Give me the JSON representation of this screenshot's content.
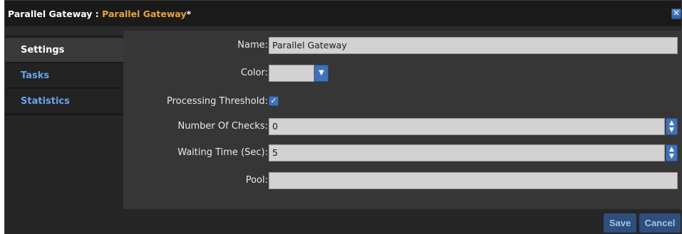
{
  "dialog": {
    "title_main": "Parallel Gateway",
    "title_separator": " : ",
    "title_accent": "Parallel Gateway",
    "title_dirty": "*",
    "close_glyph": "✕"
  },
  "sidebar": {
    "items": [
      {
        "label": "Settings",
        "active": true
      },
      {
        "label": "Tasks",
        "active": false
      },
      {
        "label": "Statistics",
        "active": false
      }
    ]
  },
  "form": {
    "name_label": "Name:",
    "name_value": "Parallel Gateway",
    "color_label": "Color:",
    "color_value": "",
    "threshold_label": "Processing Threshold:",
    "threshold_checked": true,
    "checks_label": "Number Of Checks:",
    "checks_value": "0",
    "waiting_label": "Waiting Time (Sec):",
    "waiting_value": "5",
    "pool_label": "Pool:",
    "pool_value": ""
  },
  "footer": {
    "save_label": "Save",
    "cancel_label": "Cancel"
  },
  "icons": {
    "close": "close-icon",
    "dropdown": "chevron-down-icon",
    "checkbox": "checkmark-icon",
    "spinner": "spinner-up-down-icon"
  },
  "colors": {
    "accent": "#e8a33c",
    "link": "#6aa3e8",
    "control": "#3f72b8"
  }
}
